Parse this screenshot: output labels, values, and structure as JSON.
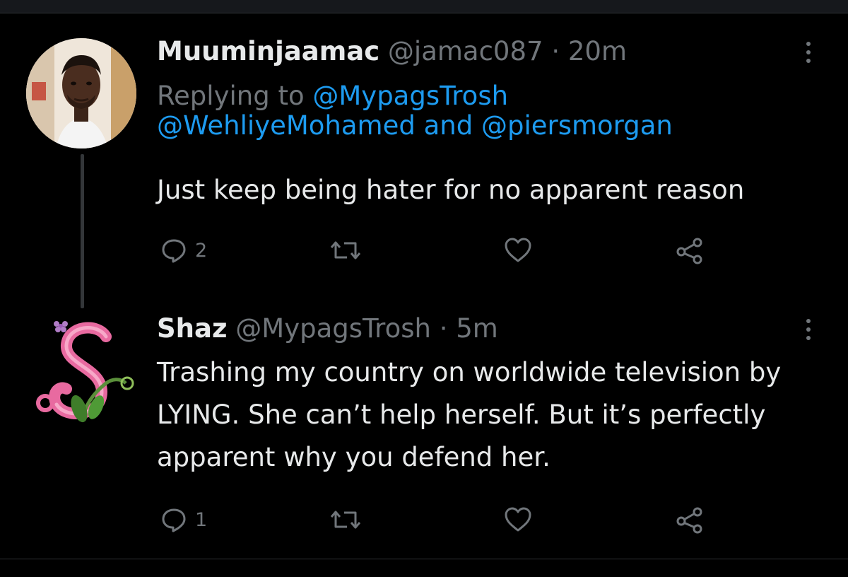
{
  "tweets": [
    {
      "name": "Muuminjaamac",
      "handle": "@jamac087",
      "separator": "·",
      "time": "20m",
      "replying_prefix": "Replying to",
      "reply_handle_1": "@MypagsTrosh",
      "reply_handle_2": "@WehliyeMohamed",
      "reply_and_1": "and",
      "reply_handle_3": "@piersmorgan",
      "text": "Just keep being hater for no apparent reason",
      "reply_count": "2",
      "avatar_icon": "profile-photo"
    },
    {
      "name": "Shaz",
      "handle": "@MypagsTrosh",
      "separator": "·",
      "time": "5m",
      "text": "Trashing my country on worldwide television by LYING. She can’t help herself. But it’s perfectly apparent why you defend her.",
      "reply_count": "1",
      "avatar_icon": "decorative-letter-s"
    }
  ],
  "icons": {
    "reply": "reply-bubble-icon",
    "retweet": "retweet-icon",
    "like": "heart-icon",
    "share": "share-icon",
    "more": "more-options-icon"
  },
  "colors": {
    "background": "#000000",
    "text": "#e7e9ea",
    "muted": "#71767b",
    "link": "#1d9bf0",
    "thread_line": "#333639"
  }
}
